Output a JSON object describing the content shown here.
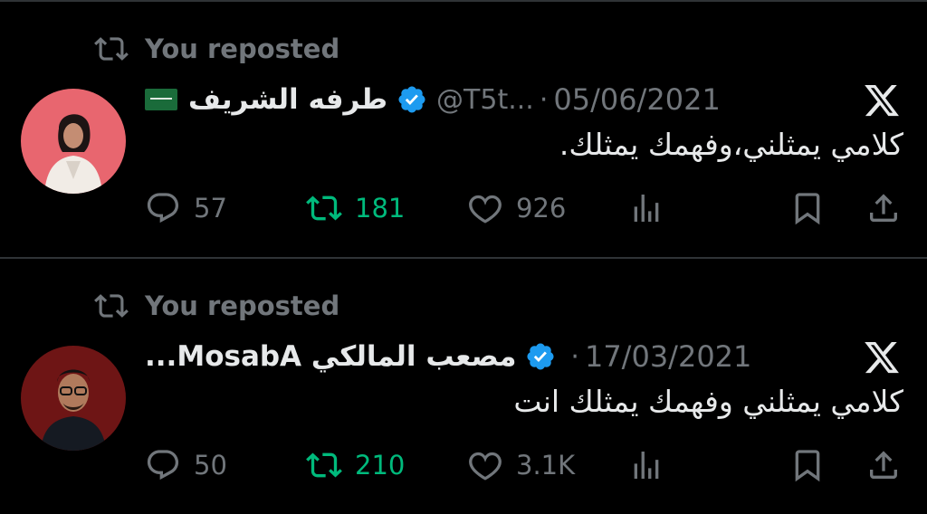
{
  "tweets": [
    {
      "repost_label": "You reposted",
      "flag": "🇸🇦",
      "name": "طرفه الشريف",
      "handle": "@T5t...",
      "separator": "·",
      "date": "05/06/2021",
      "text": "كلامي يمثلني،وفهمك يمثلك.",
      "replies": "57",
      "reposts": "181",
      "likes": "926",
      "avatar_bg": "#e8666f"
    },
    {
      "repost_label": "You reposted",
      "flag": "",
      "name": "مصعب المالكي MosabA...",
      "handle": "",
      "separator": "·",
      "date": "17/03/2021",
      "text": "كلامي يمثلني وفهمك يمثلك انت",
      "replies": "50",
      "reposts": "210",
      "likes": "3.1K",
      "avatar_bg": "#7a1a1a"
    }
  ],
  "colors": {
    "verified": "#1d9bf0",
    "repost_active": "#00ba7c",
    "muted": "#71767b",
    "text": "#e7e9ea",
    "background": "#000000"
  },
  "icons": [
    "repost-icon",
    "verified-badge-icon",
    "x-logo-icon",
    "reply-icon",
    "like-icon",
    "views-icon",
    "bookmark-icon",
    "share-icon"
  ]
}
